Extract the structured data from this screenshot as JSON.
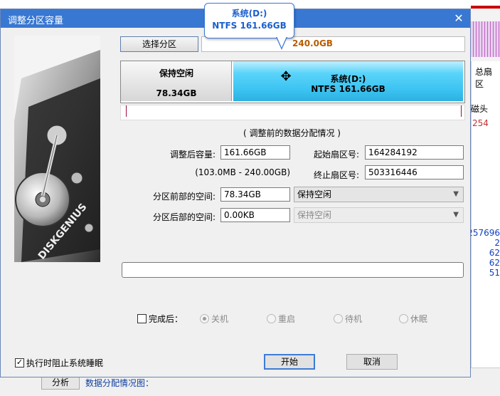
{
  "background": {
    "right_header_total": "总扇区",
    "right_header_head": "磁头",
    "right_red_value": "254",
    "right_blue_values": [
      "257696",
      "2",
      "62",
      "62",
      "51"
    ],
    "analyze_button": "分析",
    "chart_label": "数据分配情况图："
  },
  "dialog": {
    "title": "调整分区容量",
    "select_partition_button": "选择分区",
    "disk_info_suffix": "240.0GB",
    "tooltip": {
      "name": "系统(D:)",
      "fs_size": "NTFS 161.66GB"
    },
    "free_block": {
      "label": "保持空闲",
      "size": "78.34GB"
    },
    "partition_block": {
      "name": "系统(D:)",
      "fs_size": "NTFS 161.66GB"
    },
    "before_caption": "( 调整前的数据分配情况 )",
    "fields": {
      "new_size_label": "调整后容量:",
      "new_size_value": "161.66GB",
      "range_hint": "(103.0MB - 240.00GB)",
      "start_sector_label": "起始扇区号:",
      "start_sector_value": "164284192",
      "end_sector_label": "终止扇区号:",
      "end_sector_value": "503316446",
      "front_space_label": "分区前部的空间:",
      "front_space_value": "78.34GB",
      "front_space_option": "保持空闲",
      "back_space_label": "分区后部的空间:",
      "back_space_value": "0.00KB",
      "back_space_option": "保持空闲"
    },
    "after_done": {
      "label": "完成后：",
      "options": [
        "关机",
        "重启",
        "待机",
        "休眠"
      ]
    },
    "prevent_sleep": {
      "label": "执行时阻止系统睡眠",
      "checked": true
    },
    "start_button": "开始",
    "cancel_button": "取消"
  }
}
